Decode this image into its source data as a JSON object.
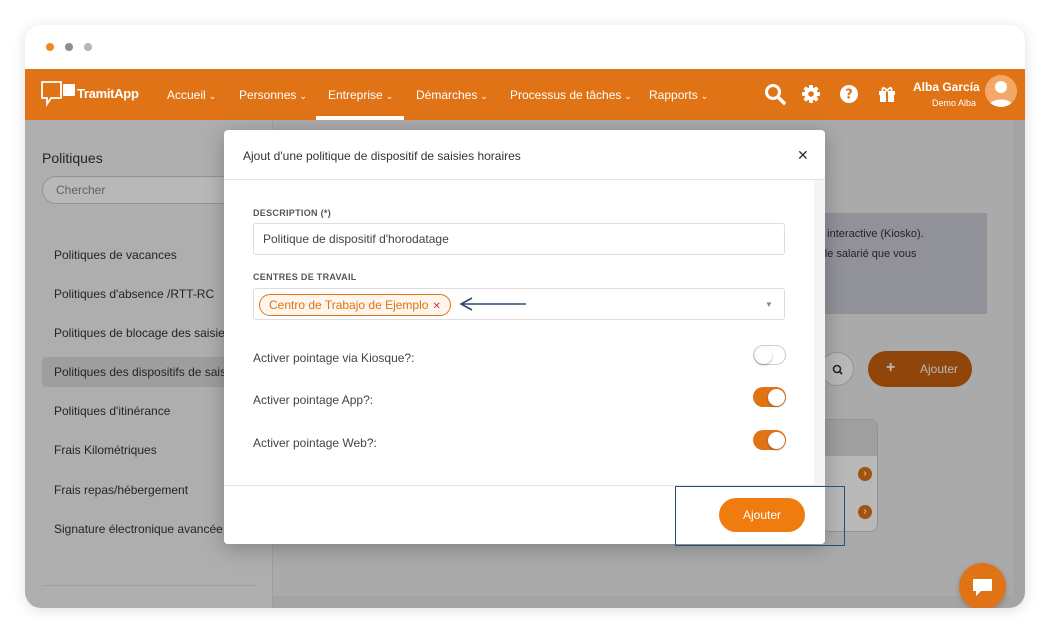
{
  "colors": {
    "brand": "#e07316",
    "annotation": "#2c4d6e",
    "toggle_on": "#e07316"
  },
  "window": {
    "dots": [
      "#f0891e",
      "#8e8e8e",
      "#b5b5b5"
    ]
  },
  "nav": {
    "logo_text": "TramitApp",
    "items": [
      {
        "label": "Accueil",
        "icon": "chevron-down-icon"
      },
      {
        "label": "Personnes",
        "icon": "chevron-down-icon"
      },
      {
        "label": "Entreprise",
        "icon": "chevron-down-icon",
        "active": true
      },
      {
        "label": "Démarches",
        "icon": "chevron-down-icon"
      },
      {
        "label": "Processus de tâches",
        "icon": "chevron-down-icon"
      },
      {
        "label": "Rapports",
        "icon": "chevron-down-icon"
      }
    ],
    "icons": [
      "search-icon",
      "gear-icon",
      "help-icon",
      "gift-icon"
    ],
    "user": {
      "name": "Alba García",
      "company": "Demo Alba"
    }
  },
  "sidebar": {
    "title": "Politiques",
    "search_placeholder": "Chercher",
    "items": [
      {
        "label": "Politiques de vacances"
      },
      {
        "label": "Politiques d'absence /RTT-RC"
      },
      {
        "label": "Politiques de blocage des saisies"
      },
      {
        "label": "Politiques des dispositifs de saisies",
        "active": true
      },
      {
        "label": "Politiques d'itinérance"
      },
      {
        "label": "Frais Kilométriques"
      },
      {
        "label": "Frais repas/hébergement"
      },
      {
        "label": "Signature électronique avancée"
      }
    ]
  },
  "main": {
    "info_line1": "e interactive (Kiosko).",
    "info_line2": "r le salarié que vous",
    "add_button": "Ajouter"
  },
  "modal": {
    "title": "Ajout d'une politique de dispositif de saisies horaires",
    "description_label": "DESCRIPTION (*)",
    "description_value": "Politique de dispositif d'horodatage",
    "centers_label": "CENTRES DE TRAVAIL",
    "center_tag": "Centro de Trabajo de Ejemplo",
    "toggles": [
      {
        "label": "Activer pointage via Kiosque?:",
        "on": false
      },
      {
        "label": "Activer pointage App?:",
        "on": true
      },
      {
        "label": "Activer pointage Web?:",
        "on": true
      }
    ],
    "submit": "Ajouter"
  }
}
